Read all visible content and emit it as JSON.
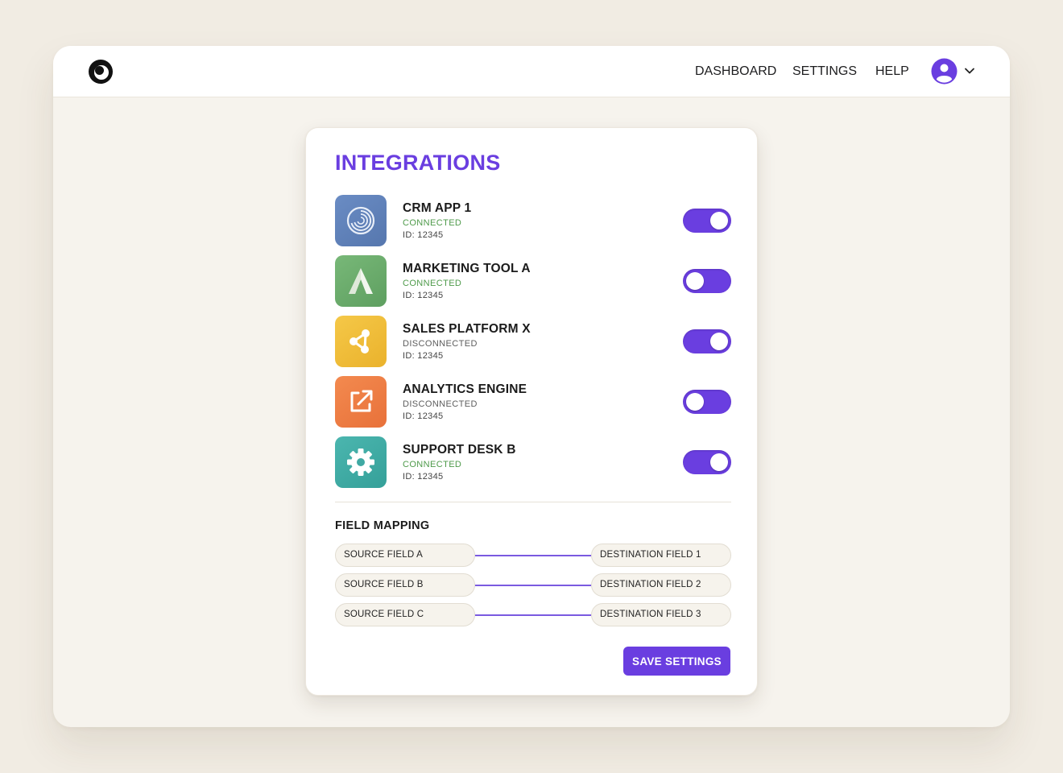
{
  "nav": {
    "items": [
      "DASHBOARD",
      "SETTINGS",
      "HELP"
    ]
  },
  "card": {
    "title": "INTEGRATIONS",
    "integrations": [
      {
        "name": "CRM APP 1",
        "status": "CONNECTED",
        "id": "ID: 12345",
        "enabled": true,
        "icon": "crm-swirl-icon",
        "color": "#5c7fb8"
      },
      {
        "name": "MARKETING TOOL A",
        "status": "CONNECTED",
        "id": "ID: 12345",
        "enabled": false,
        "icon": "letter-a-icon",
        "color": "#6aaa6a"
      },
      {
        "name": "SALES PLATFORM X",
        "status": "DISCONNECTED",
        "id": "ID: 12345",
        "enabled": true,
        "icon": "share-nodes-icon",
        "color": "#f0bd35"
      },
      {
        "name": "ANALYTICS ENGINE",
        "status": "DISCONNECTED",
        "id": "ID: 12345",
        "enabled": false,
        "icon": "external-link-icon",
        "color": "#ef7d43"
      },
      {
        "name": "SUPPORT DESK B",
        "status": "CONNECTED",
        "id": "ID: 12345",
        "enabled": true,
        "icon": "gear-icon",
        "color": "#3fa9a3"
      }
    ],
    "field_mapping": {
      "title": "FIELD MAPPING",
      "rows": [
        {
          "source": "SOURCE FIELD A",
          "destination": "DESTINATION FIELD 1"
        },
        {
          "source": "SOURCE FIELD B",
          "destination": "DESTINATION FIELD 2"
        },
        {
          "source": "SOURCE FIELD C",
          "destination": "DESTINATION FIELD 3"
        }
      ]
    },
    "save_label": "SAVE SETTINGS"
  },
  "colors": {
    "accent": "#6a3ee0",
    "connected": "#4e9a4a",
    "disconnected": "#5d5d5d",
    "background": "#f1ece3"
  }
}
